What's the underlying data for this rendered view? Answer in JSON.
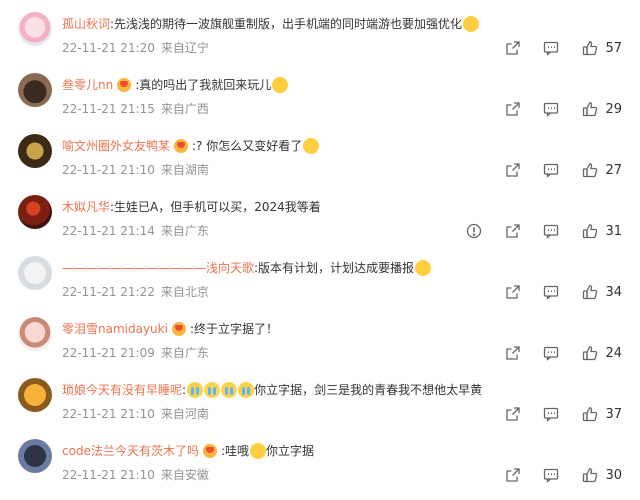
{
  "colors": {
    "username": "#eb7350",
    "meta": "#939393",
    "text": "#333333"
  },
  "comments": [
    {
      "user": "孤山秋词",
      "badge": false,
      "text": ":先浅浅的期待一波旗舰重制版，出手机端的同时端游也要加强优化",
      "emoji": [
        "emoji-face"
      ],
      "time": "22-11-21 21:20",
      "location": "来自辽宁",
      "likes": "57",
      "report": false
    },
    {
      "user": "叁零儿nn",
      "badge": true,
      "text": ":真的吗出了我就回来玩儿",
      "emoji": [
        "emoji-face"
      ],
      "time": "22-11-21 21:15",
      "location": "来自广西",
      "likes": "29",
      "report": false
    },
    {
      "user": "喻文州圈外女友鸭某",
      "badge": true,
      "text": ":? 你怎么又变好看了",
      "emoji": [
        "emoji-face"
      ],
      "time": "22-11-21 21:10",
      "location": "来自湖南",
      "likes": "27",
      "report": false
    },
    {
      "user": "木姒凡华",
      "badge": false,
      "text": ":生娃已A，但手机可以买，2024我等着",
      "emoji": [],
      "time": "22-11-21 21:14",
      "location": "来自广东",
      "likes": "31",
      "report": true
    },
    {
      "user": "————————————浅向天歌",
      "badge": false,
      "text": ":版本有计划，计划达成要播报",
      "emoji": [
        "emoji-face"
      ],
      "time": "22-11-21 21:22",
      "location": "来自北京",
      "likes": "34",
      "report": false
    },
    {
      "user": "零泪雪namidayuki",
      "badge": true,
      "text": ":终于立字据了！",
      "emoji": [],
      "time": "22-11-21 21:09",
      "location": "来自广东",
      "likes": "24",
      "report": false
    },
    {
      "user": "琐娘今天有没有早睡呢",
      "badge": false,
      "text": "你立字据，剑三是我的青春我不想他太早黄",
      "prefix": ":",
      "emoji_before": [
        "cry",
        "cry",
        "cry",
        "cry"
      ],
      "emoji": [],
      "time": "22-11-21 21:10",
      "location": "来自河南",
      "likes": "37",
      "report": false
    },
    {
      "user": "code法兰今天有茨木了吗",
      "badge": true,
      "text": "你立字据",
      "prefix": ":哇哦",
      "emoji_before": [
        "emoji-face"
      ],
      "emoji": [],
      "time": "22-11-21 21:10",
      "location": "来自安徽",
      "likes": "30",
      "report": false
    }
  ]
}
